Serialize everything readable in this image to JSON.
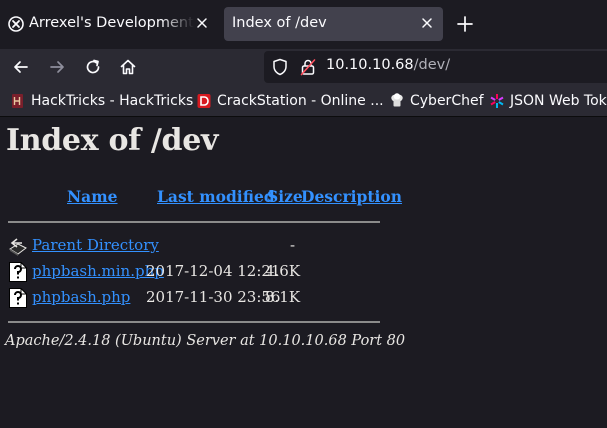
{
  "browser": {
    "tabs": [
      {
        "title": "Arrexel's Development Site",
        "favicon": "globe-x-icon",
        "active": false
      },
      {
        "title": "Index of /dev",
        "active": true
      }
    ],
    "url": {
      "host": "10.10.10.68",
      "path": "/dev/"
    },
    "bookmarks": [
      {
        "label": "HackTricks - HackTricks",
        "icon": "hacktricks-icon"
      },
      {
        "label": "CrackStation - Online ...",
        "icon": "crackstation-icon"
      },
      {
        "label": "CyberChef",
        "icon": "cyberchef-icon"
      },
      {
        "label": "JSON Web Tok",
        "icon": "jwt-icon"
      }
    ]
  },
  "page": {
    "heading": "Index of /dev",
    "columns": {
      "name": "Name",
      "modified": "Last modified",
      "size": "Size",
      "description": "Description"
    },
    "parent": {
      "name": "Parent Directory",
      "size": "-"
    },
    "files": [
      {
        "name": "phpbash.min.php",
        "modified": "2017-12-04 12:21",
        "size": "4.6K"
      },
      {
        "name": "phpbash.php",
        "modified": "2017-11-30 23:56",
        "size": "8.1K"
      }
    ],
    "address": "Apache/2.4.18 (Ubuntu) Server at 10.10.10.68 Port 80"
  },
  "colors": {
    "link": "#3391ff",
    "page_bg": "#1c1b22",
    "toolbar_bg": "#2b2a33",
    "active_tab_bg": "#42414d"
  }
}
